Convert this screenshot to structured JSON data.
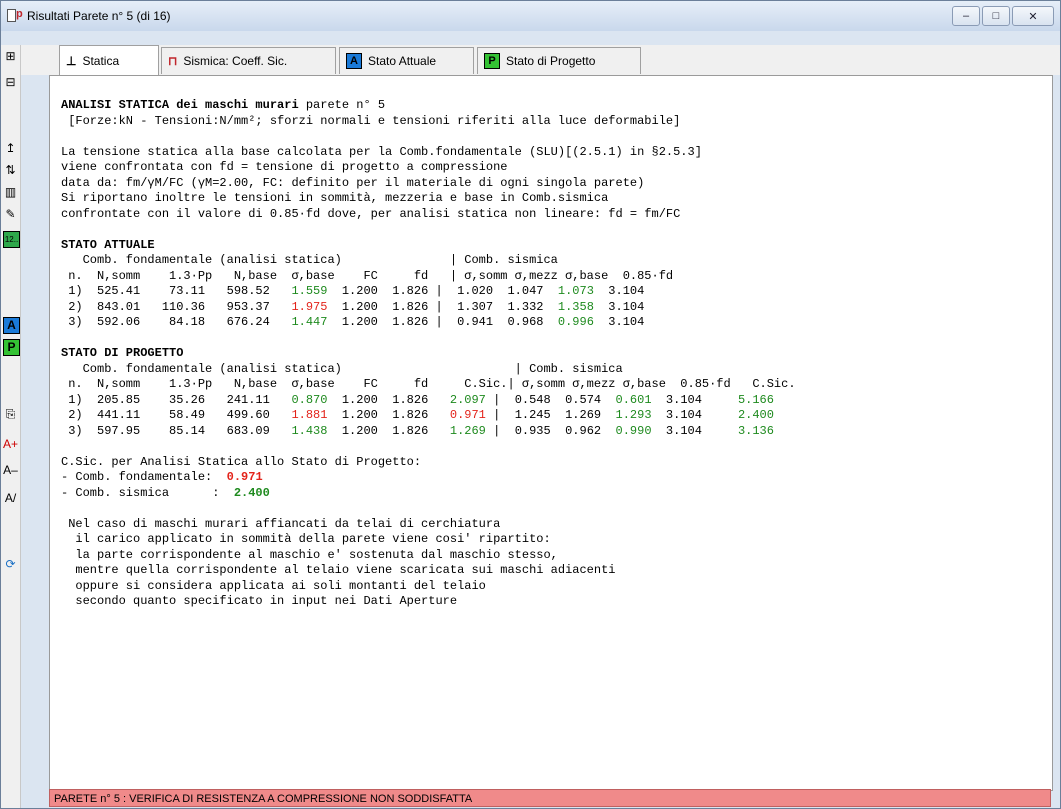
{
  "window": {
    "title": "Risultati Parete n° 5 (di 16)",
    "minimize": "–",
    "maximize": "□",
    "close": "✕"
  },
  "tabs": [
    {
      "label": "Statica"
    },
    {
      "label": "Sismica: Coeff. Sic."
    },
    {
      "label": "Stato Attuale",
      "box": "A"
    },
    {
      "label": "Stato di Progetto",
      "box": "P"
    }
  ],
  "toolbar": {
    "stato_attuale_box": "A",
    "stato_progetto_box": "P",
    "num_box": "12.."
  },
  "content": {
    "title_bold": "ANALISI STATICA dei maschi murari",
    "title_rest": " parete n° 5",
    "units": " [Forze:kN - Tensioni:N/mm²; sforzi normali e tensioni riferiti alla luce deformabile]",
    "intro": [
      "La tensione statica alla base calcolata per la Comb.fondamentale (SLU)[(2.5.1) in §2.5.3]",
      "viene confrontata con fd = tensione di progetto a compressione",
      "data da: fm/γM/FC (γM=2.00, FC: definito per il materiale di ogni singola parete)",
      "Si riportano inoltre le tensioni in sommità, mezzeria e base in Comb.sismica",
      "confrontate con il valore di 0.85·fd dove, per analisi statica non lineare: fd = fm/FC"
    ],
    "attuale": {
      "heading": "STATO ATTUALE",
      "header1": "   Comb. fondamentale (analisi statica)               | Comb. sismica",
      "header2": " n.  N,somm    1.3·Pp   N,base  σ,base    FC     fd   | σ,somm σ,mezz σ,base  0.85·fd",
      "rows": [
        {
          "pre": " 1)  525.41    73.11   598.52   ",
          "sigma": "1.559",
          "sc": "g",
          "mid": "  1.200  1.826 |  1.020  1.047  ",
          "sb": "1.073",
          "sbc": "g",
          "end": "  3.104"
        },
        {
          "pre": " 2)  843.01   110.36   953.37   ",
          "sigma": "1.975",
          "sc": "r",
          "mid": "  1.200  1.826 |  1.307  1.332  ",
          "sb": "1.358",
          "sbc": "g",
          "end": "  3.104"
        },
        {
          "pre": " 3)  592.06    84.18   676.24   ",
          "sigma": "1.447",
          "sc": "g",
          "mid": "  1.200  1.826 |  0.941  0.968  ",
          "sb": "0.996",
          "sbc": "g",
          "end": "  3.104"
        }
      ]
    },
    "progetto": {
      "heading": "STATO DI PROGETTO",
      "header1": "   Comb. fondamentale (analisi statica)                        | Comb. sismica",
      "header2": " n.  N,somm    1.3·Pp   N,base  σ,base    FC     fd     C.Sic.| σ,somm σ,mezz σ,base  0.85·fd   C.Sic.",
      "rows": [
        {
          "pre": " 1)  205.85    35.26   241.11   ",
          "sigma": "0.870",
          "sc": "g",
          "mid": "  1.200  1.826   ",
          "cs": "2.097",
          "csc": "g",
          "mid2": " |  0.548  0.574  ",
          "sb": "0.601",
          "sbc": "g",
          "mid3": "  3.104     ",
          "cs2": "5.166",
          "cs2c": "g"
        },
        {
          "pre": " 2)  441.11    58.49   499.60   ",
          "sigma": "1.881",
          "sc": "r",
          "mid": "  1.200  1.826   ",
          "cs": "0.971",
          "csc": "r",
          "mid2": " |  1.245  1.269  ",
          "sb": "1.293",
          "sbc": "g",
          "mid3": "  3.104     ",
          "cs2": "2.400",
          "cs2c": "g"
        },
        {
          "pre": " 3)  597.95    85.14   683.09   ",
          "sigma": "1.438",
          "sc": "g",
          "mid": "  1.200  1.826   ",
          "cs": "1.269",
          "csc": "g",
          "mid2": " |  0.935  0.962  ",
          "sb": "0.990",
          "sbc": "g",
          "mid3": "  3.104     ",
          "cs2": "3.136",
          "cs2c": "g"
        }
      ]
    },
    "csic_title": "C.Sic. per Analisi Statica allo Stato di Progetto:",
    "csic_fond_label": "- Comb. fondamentale:  ",
    "csic_fond_value": "0.971",
    "csic_sism_label": "- Comb. sismica      :  ",
    "csic_sism_value": "2.400",
    "note": [
      " Nel caso di maschi murari affiancati da telai di cerchiatura",
      "  il carico applicato in sommità della parete viene cosi' ripartito:",
      "  la parte corrispondente al maschio e' sostenuta dal maschio stesso,",
      "  mentre quella corrispondente al telaio viene scaricata sui maschi adiacenti",
      "  oppure si considera applicata ai soli montanti del telaio",
      "  secondo quanto specificato in input nei Dati Aperture"
    ]
  },
  "status": "PARETE n° 5 : VERIFICA DI RESISTENZA A COMPRESSIONE NON SODDISFATTA",
  "colors": {
    "red": "#e3241b",
    "green": "#1e8a1e",
    "status_bg": "#f08a8a"
  }
}
